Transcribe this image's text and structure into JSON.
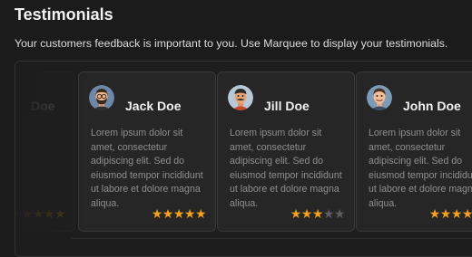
{
  "page": {
    "title": "Testimonials",
    "subtitle": "Your customers feedback is important to you. Use Marquee to display your testimonials."
  },
  "colors": {
    "accent_star": "#f4a11d",
    "star_off": "#5d5d5d",
    "background": "#1b1b1b",
    "card": "#262626"
  },
  "testimonials": [
    {
      "name": "Doe",
      "text": "",
      "rating": 5,
      "avatar": "avatar-icon"
    },
    {
      "name": "Jack Doe",
      "text": "Lorem ipsum dolor sit amet, consectetur adipiscing elit. Sed do eiusmod tempor incididunt ut labore et dolore magna aliqua.",
      "rating": 5,
      "avatar": "bearded-man-avatar-icon"
    },
    {
      "name": "Jill Doe",
      "text": "Lorem ipsum dolor sit amet, consectetur adipiscing elit. Sed do eiusmod tempor incididunt ut labore et dolore magna aliqua.",
      "rating": 3,
      "avatar": "mustached-man-avatar-icon"
    },
    {
      "name": "John Doe",
      "text": "Lorem ipsum dolor sit amet, consectetur adipiscing elit. Sed do eiusmod tempor incididunt ut labore et dolore magna aliqua.",
      "rating": 4,
      "avatar": "smiling-man-avatar-icon"
    }
  ]
}
